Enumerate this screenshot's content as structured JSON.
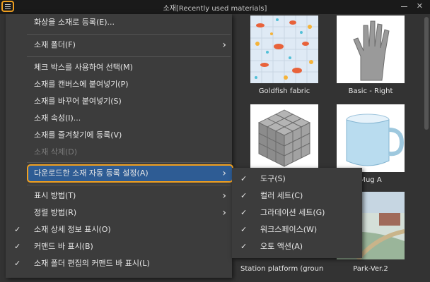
{
  "window": {
    "title": "소재[Recently used materials]",
    "menu_icon": "hamburger-icon",
    "close_glyph": "✕"
  },
  "materials": [
    {
      "label": "Goldfish fabric",
      "icon": "goldfish-fabric-thumbnail"
    },
    {
      "label": "Basic - Right",
      "icon": "hand-thumbnail"
    },
    {
      "label": "",
      "icon": "cube-thumbnail"
    },
    {
      "label": "Mug A",
      "icon": "mug-thumbnail"
    },
    {
      "label": "Station platform (ground leve",
      "icon": "station-platform-thumbnail"
    },
    {
      "label": "Park-Ver.2",
      "icon": "park-thumbnail"
    }
  ],
  "menu": {
    "items": [
      {
        "label": "화상을 소재로 등록(E)..."
      },
      {
        "label": "소재 폴더(F)",
        "arrow": "›"
      },
      {
        "label": "체크 박스를 사용하여 선택(M)"
      },
      {
        "label": "소재를 캔버스에 붙여넣기(P)"
      },
      {
        "label": "소재를 바꾸어 붙여넣기(S)"
      },
      {
        "label": "소재 속성(I)..."
      },
      {
        "label": "소재를 즐겨찾기에 등록(V)"
      },
      {
        "label": "소재 삭제(D)"
      },
      {
        "label": "다운로드한 소재 자동 등록 설정(A)",
        "arrow": "›"
      },
      {
        "label": "표시 방법(T)",
        "arrow": "›"
      },
      {
        "label": "정렬 방법(R)",
        "arrow": "›"
      },
      {
        "label": "소재 상세 정보 표시(O)",
        "check": "✓"
      },
      {
        "label": "커맨드 바 표시(B)",
        "check": "✓"
      },
      {
        "label": "소재 폴더 편집의 커맨드 바 표시(L)",
        "check": "✓"
      }
    ]
  },
  "submenu": {
    "items": [
      {
        "label": "도구(S)",
        "check": "✓"
      },
      {
        "label": "컬러 세트(C)",
        "check": "✓"
      },
      {
        "label": "그라데이션 세트(G)",
        "check": "✓"
      },
      {
        "label": "워크스페이스(W)",
        "check": "✓"
      },
      {
        "label": "오토 액션(A)",
        "check": "✓"
      }
    ]
  },
  "colors": {
    "accent": "#f0a020",
    "highlight": "#2e5c94",
    "menu_bg": "#3c3c3c",
    "panel_bg": "#333333"
  }
}
